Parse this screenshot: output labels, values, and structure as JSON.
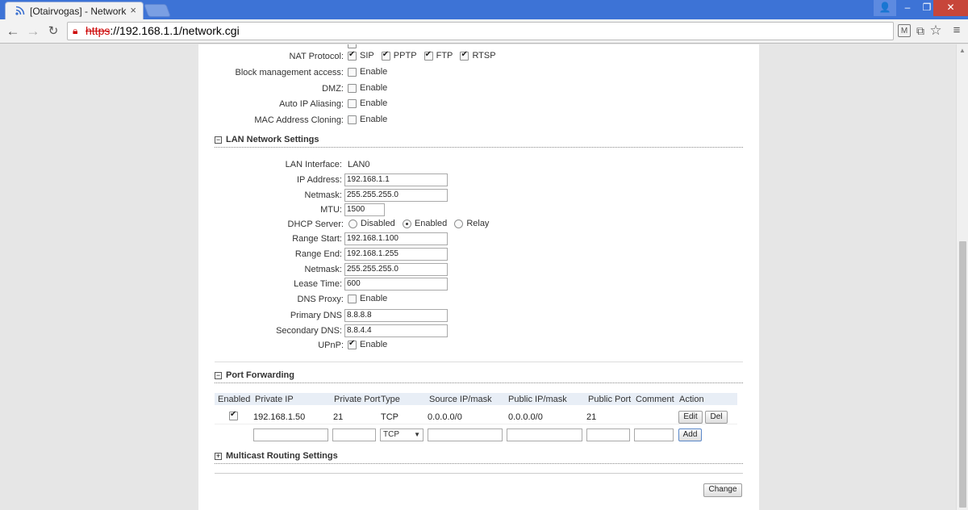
{
  "browser": {
    "tab_title": "[Otairvogas] - Network",
    "url_scheme": "https",
    "url_rest": "://192.168.1.1/network.cgi"
  },
  "nat": {
    "label": "NAT Protocol:",
    "items": [
      {
        "label": "SIP",
        "checked": true
      },
      {
        "label": "PPTP",
        "checked": true
      },
      {
        "label": "FTP",
        "checked": true
      },
      {
        "label": "RTSP",
        "checked": true
      }
    ]
  },
  "options": [
    {
      "label": "Block management access:",
      "value": "Enable",
      "checked": false
    },
    {
      "label": "DMZ:",
      "value": "Enable",
      "checked": false
    },
    {
      "label": "Auto IP Aliasing:",
      "value": "Enable",
      "checked": false
    },
    {
      "label": "MAC Address Cloning:",
      "value": "Enable",
      "checked": false
    }
  ],
  "lan": {
    "section_title": "LAN Network Settings",
    "interface_label": "LAN Interface:",
    "interface_value": "LAN0",
    "ip_label": "IP Address:",
    "ip_value": "192.168.1.1",
    "netmask_label": "Netmask:",
    "netmask_value": "255.255.255.0",
    "mtu_label": "MTU:",
    "mtu_value": "1500",
    "dhcp_label": "DHCP Server:",
    "dhcp_options": [
      "Disabled",
      "Enabled",
      "Relay"
    ],
    "dhcp_selected": "Enabled",
    "range_start_label": "Range Start:",
    "range_start_value": "192.168.1.100",
    "range_end_label": "Range End:",
    "range_end_value": "192.168.1.255",
    "dhcp_netmask_label": "Netmask:",
    "dhcp_netmask_value": "255.255.255.0",
    "lease_label": "Lease Time:",
    "lease_value": "600",
    "dns_proxy_label": "DNS Proxy:",
    "dns_proxy_value": "Enable",
    "primary_dns_label": "Primary DNS",
    "primary_dns_value": "8.8.8.8",
    "secondary_dns_label": "Secondary DNS:",
    "secondary_dns_value": "8.8.4.4",
    "upnp_label": "UPnP:",
    "upnp_value": "Enable"
  },
  "port_forwarding": {
    "section_title": "Port Forwarding",
    "headers": [
      "Enabled",
      "Private IP",
      "Private Port",
      "Type",
      "Source IP/mask",
      "Public IP/mask",
      "Public Port",
      "Comment",
      "Action"
    ],
    "rows": [
      {
        "enabled": true,
        "private_ip": "192.168.1.50",
        "private_port": "21",
        "type": "TCP",
        "source": "0.0.0.0/0",
        "public_ip": "0.0.0.0/0",
        "public_port": "21",
        "comment": ""
      }
    ],
    "edit_label": "Edit",
    "del_label": "Del",
    "new_type": "TCP",
    "add_label": "Add"
  },
  "multicast": {
    "section_title": "Multicast Routing Settings"
  },
  "change_label": "Change"
}
